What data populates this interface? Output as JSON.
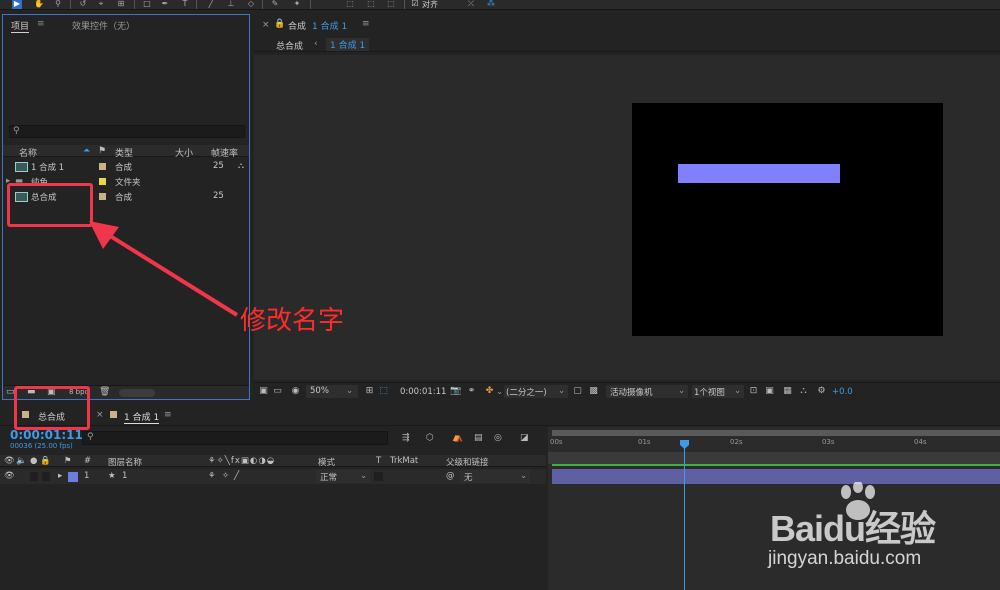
{
  "toolbar": {
    "align_label": "对齐"
  },
  "project_panel": {
    "tab_project": "项目",
    "tab_effects": "效果控件（无）",
    "columns": {
      "name": "名称",
      "type": "类型",
      "size": "大小",
      "fps": "帧速率"
    },
    "items": [
      {
        "name": "1 合成 1",
        "type": "合成",
        "fps": "25",
        "swatch": "#c9b283"
      },
      {
        "name": "纯色",
        "type": "文件夹",
        "fps": "",
        "swatch": "#e8d84e"
      },
      {
        "name": "总合成",
        "type": "合成",
        "fps": "25",
        "swatch": "#c9b283"
      }
    ],
    "bit_depth": "8 bpc"
  },
  "composition": {
    "tab_label": "合成",
    "tab_name": "1 合成 1",
    "breadcrumb_root": "总合成",
    "breadcrumb_current": "1 合成 1",
    "zoom": "50%",
    "time": "0:00:01:11",
    "resolution": "(二分之一)",
    "camera": "活动摄像机",
    "views": "1个视图",
    "exposure": "+0.0",
    "layer_color": "#8080ff"
  },
  "timeline": {
    "tab_root": "总合成",
    "tab_comp": "1 合成 1",
    "timecode": "0:00:01:11",
    "frame_info": "00036 (25.00 fps)",
    "columns": {
      "layer_name": "图层名称",
      "mode": "模式",
      "t": "T",
      "trkmat": "TrkMat",
      "parent": "父级和链接"
    },
    "layer": {
      "index": "1",
      "name": "1",
      "mode": "正常",
      "parent": "无",
      "color": "#6d7ee0"
    },
    "ruler_ticks": [
      "00s",
      "01s",
      "02s",
      "03s",
      "04s"
    ]
  },
  "annotation": {
    "text": "修改名字",
    "color": "#f0364a"
  },
  "watermark": {
    "brand": "Baidu经验",
    "url": "jingyan.baidu.com"
  }
}
